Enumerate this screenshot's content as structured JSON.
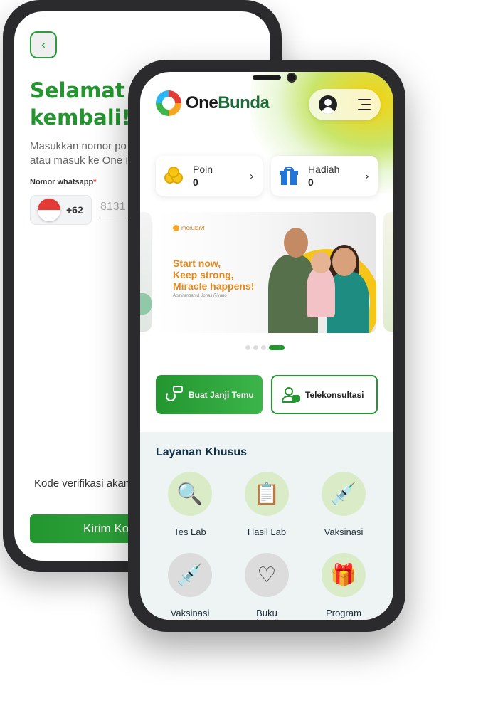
{
  "back_screen": {
    "back_icon": "chevron-left-icon",
    "welcome_title": "Selamat d\nkembali!",
    "intro_text": "Masukkan nomor po\natau masuk ke One I",
    "whatsapp_label": "Nomor whatsapp",
    "required_mark": "*",
    "country_code": "+62",
    "phone_value": "8131",
    "verification_text": "Kode verifikasi akan",
    "send_button": "Kirim Ko"
  },
  "front_screen": {
    "logo": {
      "one": "One",
      "bunda": "Bunda"
    },
    "header_icons": [
      "user-icon",
      "menu-icon"
    ],
    "cards": {
      "poin": {
        "label": "Poin",
        "value": "0",
        "icon": "coins-icon"
      },
      "hadiah": {
        "label": "Hadiah",
        "value": "0",
        "icon": "gift-icon"
      }
    },
    "banner": {
      "brand": "morulaivf",
      "headline": "Start now,\nKeep strong,\nMiracle happens!",
      "sub": "Acmirandah & Jonas Rivano"
    },
    "carousel": {
      "count": 4,
      "active": 4
    },
    "actions": {
      "janji": "Buat Janji Temu",
      "tele": "Telekonsultasi"
    },
    "section_title": "Layanan Khusus",
    "services": [
      {
        "label": "Tes Lab",
        "icon": "lab-test-icon"
      },
      {
        "label": "Hasil Lab",
        "icon": "clipboard-icon"
      },
      {
        "label": "Vaksinasi",
        "icon": "vaccine-icon"
      },
      {
        "label": "Vaksinasi\nAnak",
        "icon": "syringe-blocks-icon"
      },
      {
        "label": "Buku\nKehamilan",
        "icon": "pregnancy-icon"
      },
      {
        "label": "Program\nLoyalty",
        "icon": "gift-hand-icon"
      }
    ]
  },
  "colors": {
    "brand_green": "#23962f",
    "accent_yellow": "#f5c518",
    "banner_orange": "#e58a1f"
  }
}
